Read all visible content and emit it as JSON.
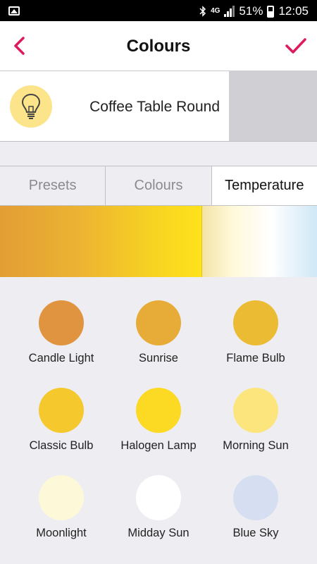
{
  "status_bar": {
    "network": "4G",
    "battery": "51%",
    "time": "12:05"
  },
  "header": {
    "title": "Colours",
    "back_icon": "chevron-left-icon",
    "confirm_icon": "checkmark-icon",
    "accent": "#e0185e"
  },
  "device": {
    "name": "Coffee Table Round",
    "icon": "lightbulb-icon"
  },
  "tabs": [
    {
      "label": "Presets",
      "active": false
    },
    {
      "label": "Colours",
      "active": false
    },
    {
      "label": "Temperature",
      "active": true
    }
  ],
  "presets": [
    {
      "label": "Candle Light",
      "color": "#e09440"
    },
    {
      "label": "Sunrise",
      "color": "#e7ac38"
    },
    {
      "label": "Flame Bulb",
      "color": "#ecbb34"
    },
    {
      "label": "Classic Bulb",
      "color": "#f5c92d"
    },
    {
      "label": "Halogen Lamp",
      "color": "#fcd922"
    },
    {
      "label": "Morning Sun",
      "color": "#fde57e"
    },
    {
      "label": "Moonlight",
      "color": "#fdf9d8"
    },
    {
      "label": "Midday Sun",
      "color": "#ffffff"
    },
    {
      "label": "Blue Sky",
      "color": "#d6dff1"
    }
  ]
}
